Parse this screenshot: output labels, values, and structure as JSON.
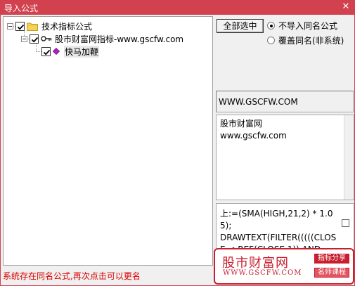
{
  "window": {
    "title": "导入公式",
    "close_glyph": "✕"
  },
  "tree": {
    "root": {
      "label": "技术指标公式",
      "checked": true
    },
    "group": {
      "label": "股市财富网指标-www.gscfw.com",
      "checked": true
    },
    "item": {
      "label": "快马加鞭",
      "checked": true
    }
  },
  "controls": {
    "select_all": "全部选中",
    "option_skip": "不导入同名公式",
    "option_overwrite": "覆盖同名(非系统)",
    "selected_option": "skip"
  },
  "info": {
    "text": "WWW.GSCFW.COM"
  },
  "description": {
    "line1": "股市财富网",
    "line2": "www.gscfw.com"
  },
  "code": {
    "text": "上:=(SMA(HIGH,21,2) * 1.05);\nDRAWTEXT(FILTER(((((CLOSE < REF(CLOSE,1)) AND"
  },
  "status": {
    "message": "系统存在同名公式,再次点击可以更名"
  },
  "watermark": {
    "brand": "股市财富网",
    "url": "WWW.GSCFW.COM",
    "tag1": "指标分享",
    "tag2": "名师课程"
  },
  "colors": {
    "titlebar": "#d1414e",
    "accent": "#c81e2d",
    "status": "#dd0000"
  },
  "icons": {
    "root": "folder-icon",
    "group": "key-icon",
    "item": "gem-icon"
  }
}
